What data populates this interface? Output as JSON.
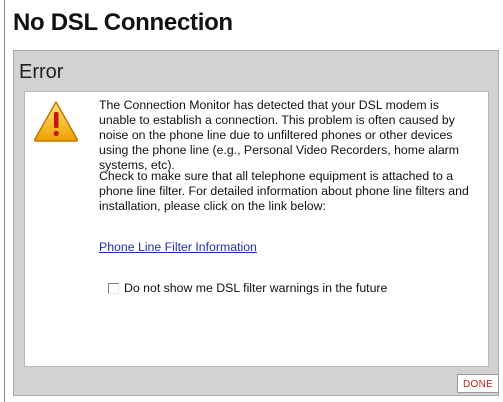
{
  "page": {
    "title": "No DSL Connection"
  },
  "panel": {
    "heading": "Error"
  },
  "message": {
    "icon": "warning-triangle-icon",
    "paragraph1": "The Connection Monitor has detected that your DSL modem is unable to establish a connection. This problem is often caused by noise on the phone line due to unfiltered phones or other devices using the phone line (e.g., Personal Video Recorders, home alarm systems, etc).",
    "paragraph2": "Check to make sure that all telephone equipment is attached to a phone line filter. For detailed information about phone line filters and installation, please click on the link below:",
    "link_text": "Phone Line Filter Information"
  },
  "options": {
    "dont_show_label": "Do not show me DSL filter warnings in the future",
    "dont_show_checked": false
  },
  "buttons": {
    "done_label": "DONE"
  },
  "colors": {
    "panel_bg": "#d2d2d2",
    "link": "#1f2fb4",
    "done_text": "#c21b1b",
    "icon_fill": "#f2b400",
    "icon_mark": "#c81414"
  }
}
